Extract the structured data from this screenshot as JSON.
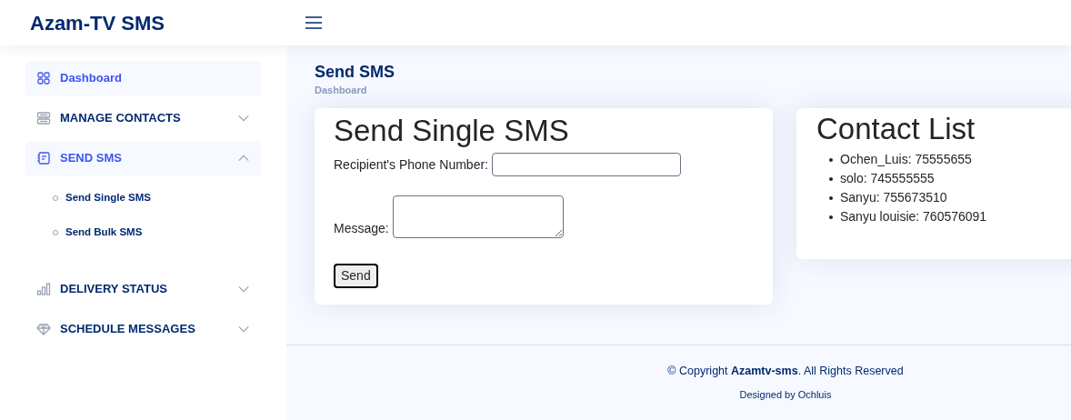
{
  "header": {
    "logo": "Azam-TV SMS"
  },
  "sidebar": {
    "items": [
      {
        "label": "Dashboard",
        "selected": true,
        "kind": "link"
      },
      {
        "label": "MANAGE CONTACTS",
        "selected": false,
        "kind": "group",
        "expanded": false
      },
      {
        "label": "SEND SMS",
        "selected": true,
        "kind": "group",
        "expanded": true,
        "children": [
          {
            "label": "Send Single SMS"
          },
          {
            "label": "Send Bulk SMS"
          }
        ]
      },
      {
        "label": "DELIVERY STATUS",
        "selected": false,
        "kind": "group",
        "expanded": false
      },
      {
        "label": "SCHEDULE MESSAGES",
        "selected": false,
        "kind": "group",
        "expanded": false
      }
    ]
  },
  "page": {
    "title": "Send SMS",
    "breadcrumb": "Dashboard"
  },
  "form": {
    "title": "Send Single SMS",
    "phone_label": "Recipient's Phone Number:",
    "message_label": "Message:",
    "button": "Send"
  },
  "contacts": {
    "title": "Contact List",
    "items": [
      "Ochen_Luis: 75555655",
      "solo: 745555555",
      "Sanyu: 755673510",
      "Sanyu louisie: 760576091"
    ]
  },
  "footer": {
    "copyright": "© Copyright **Azamtv-sms**. All Rights Reserved",
    "credit": "Designed by Ochluis"
  }
}
